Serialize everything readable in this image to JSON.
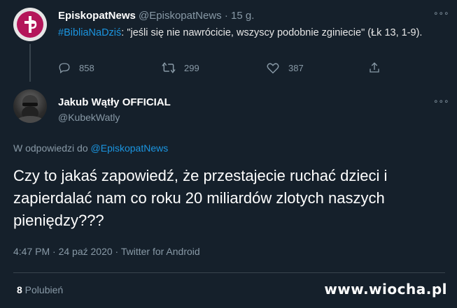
{
  "tweet1": {
    "name": "EpiskopatNews",
    "handle": "@EpiskopatNews",
    "separator": "·",
    "time": "15 g.",
    "hashtag": "#BibliaNaDziś",
    "text": ": \"jeśli się nie nawrócicie, wszyscy podobnie zginiecie\" (Łk 13, 1-9).",
    "more_glyph": "∘∘∘",
    "replies": "858",
    "retweets": "299",
    "likes": "387"
  },
  "tweet2": {
    "name": "Jakub Wątły OFFICIAL",
    "handle": "@KubekWatly",
    "more_glyph": "∘∘∘",
    "reply_prefix": "W odpowiedzi do ",
    "reply_to": "@EpiskopatNews",
    "text": "Czy to jakaś zapowiedź, że przestajecie ruchać dzieci i zapierdalać nam co roku 20 miliardów zlotych naszych pieniędzy???",
    "meta": "4:47 PM · 24 paź 2020 · Twitter for Android",
    "likes_count": "8",
    "likes_label": " Polubień"
  },
  "watermark": "www.wiocha.pl",
  "colors": {
    "background": "#15202b",
    "accent": "#1b95e0",
    "muted": "#8899a6",
    "brand_avatar": "#b4165a"
  },
  "icons": [
    "cross-logo-icon",
    "reply-icon",
    "retweet-icon",
    "like-icon",
    "share-icon",
    "more-icon"
  ]
}
